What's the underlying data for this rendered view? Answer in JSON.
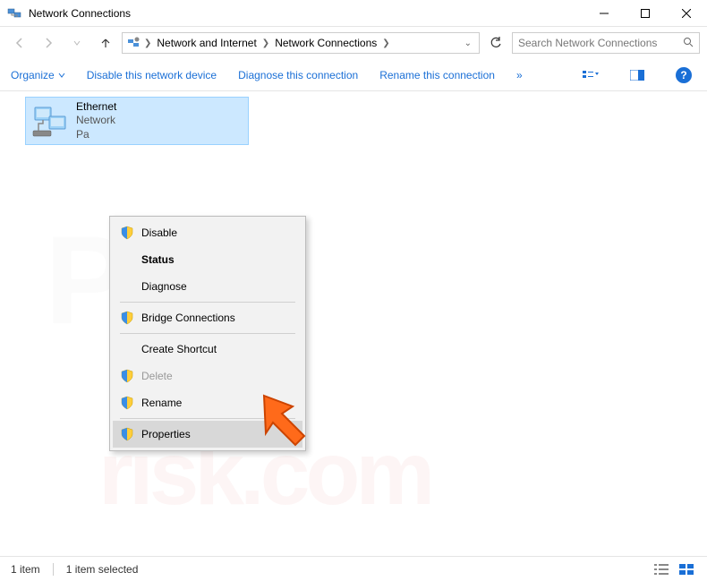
{
  "window": {
    "title": "Network Connections"
  },
  "breadcrumb": {
    "parts": [
      "Network and Internet",
      "Network Connections"
    ]
  },
  "search": {
    "placeholder": "Search Network Connections"
  },
  "toolbar": {
    "organize": "Organize",
    "disable": "Disable this network device",
    "diagnose": "Diagnose this connection",
    "rename": "Rename this connection",
    "more": "»"
  },
  "adapter": {
    "name": "Ethernet",
    "sub1": "Network",
    "sub2": "Pa"
  },
  "contextMenu": {
    "disable": "Disable",
    "status": "Status",
    "diagnose": "Diagnose",
    "bridge": "Bridge Connections",
    "shortcut": "Create Shortcut",
    "delete": "Delete",
    "rename": "Rename",
    "properties": "Properties"
  },
  "statusbar": {
    "count": "1 item",
    "selected": "1 item selected"
  }
}
